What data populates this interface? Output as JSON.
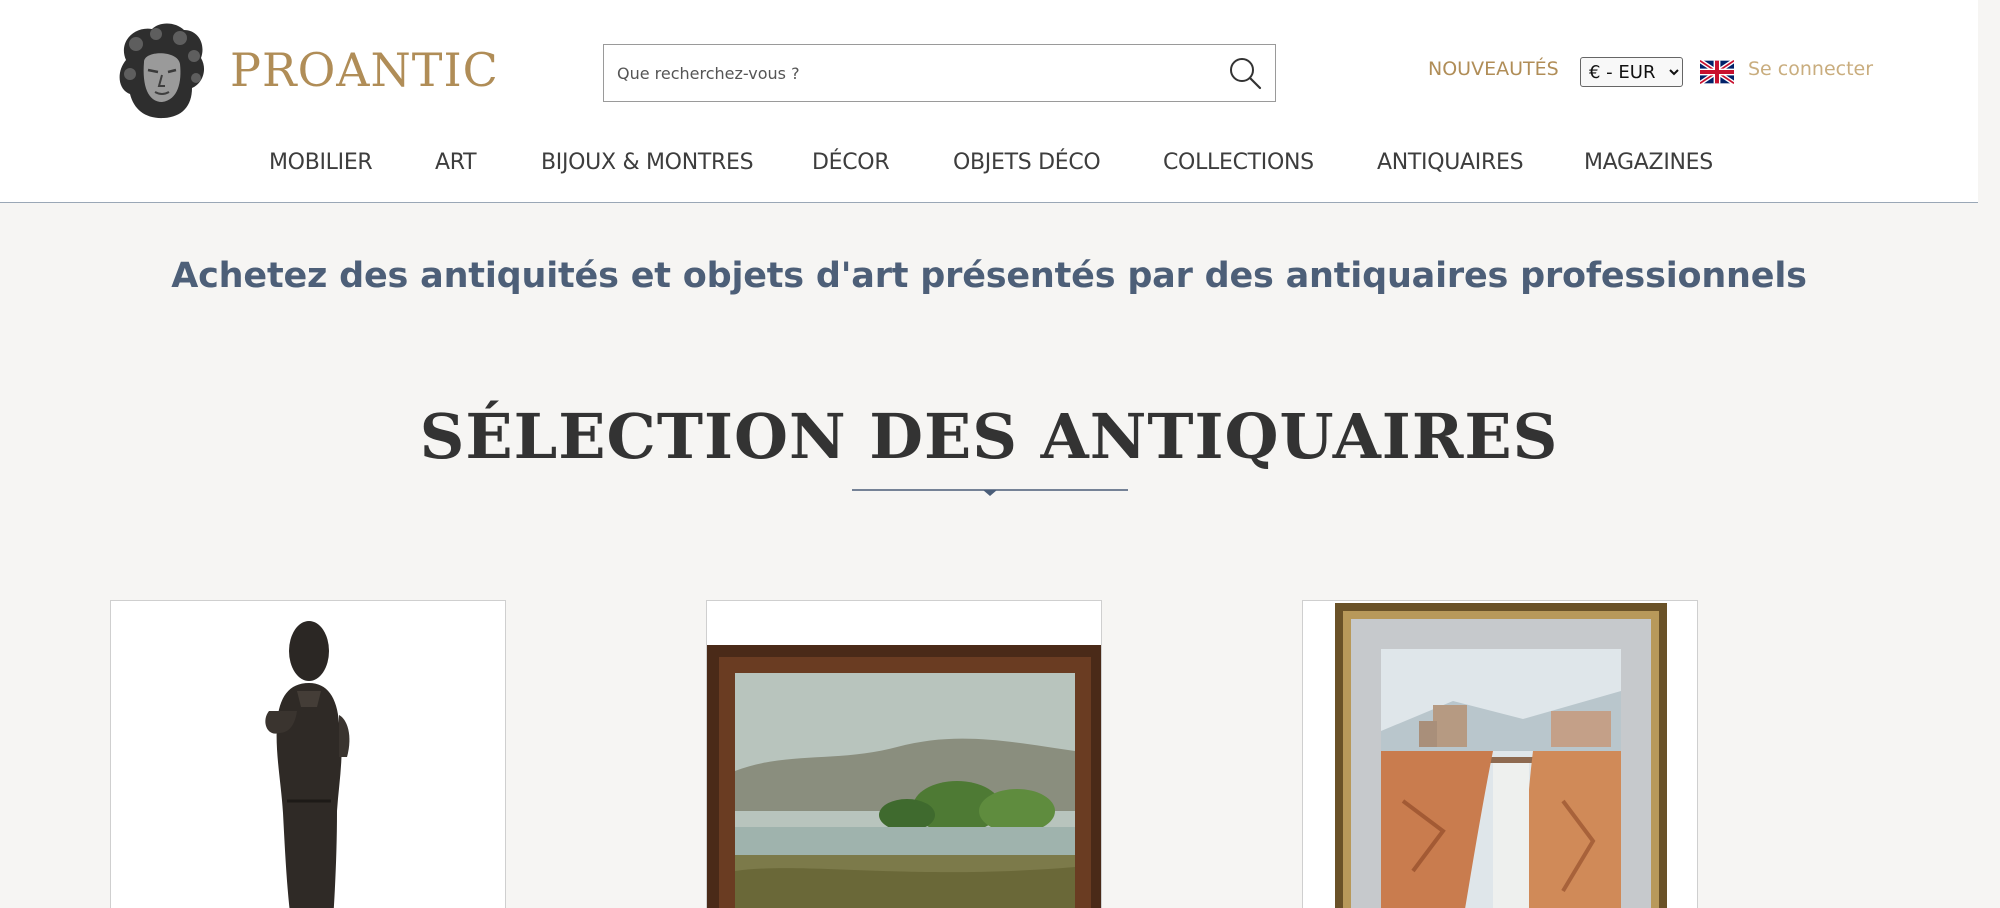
{
  "header": {
    "logo_text": "PROANTIC",
    "search_placeholder": "Que recherchez-vous ?",
    "nouveautes_label": "NOUVEAUTÉS",
    "currency_options": [
      "€ - EUR"
    ],
    "currency_selected": "€ - EUR",
    "login_label": "Se connecter"
  },
  "nav": {
    "items": [
      {
        "label": "MOBILIER"
      },
      {
        "label": "ART"
      },
      {
        "label": "BIJOUX & MONTRES"
      },
      {
        "label": "DÉCOR"
      },
      {
        "label": "OBJETS DÉCO"
      },
      {
        "label": "COLLECTIONS"
      },
      {
        "label": "ANTIQUAIRES"
      },
      {
        "label": "MAGAZINES"
      }
    ]
  },
  "main": {
    "tagline": "Achetez des antiquités et objets d'art présentés par des antiquaires professionnels",
    "section_title": "SÉLECTION DES ANTIQUAIRES"
  },
  "colors": {
    "brand_gold": "#b08d57",
    "login_gold": "#c9ad7e",
    "tagline_blue": "#4d5f78",
    "divider": "#4a5d78",
    "page_background": "#f6f5f3"
  },
  "icons": {
    "search": "search-icon",
    "flag": "uk-flag-icon",
    "logo": "logo-head-icon",
    "divider_marker": "diamond-icon"
  }
}
